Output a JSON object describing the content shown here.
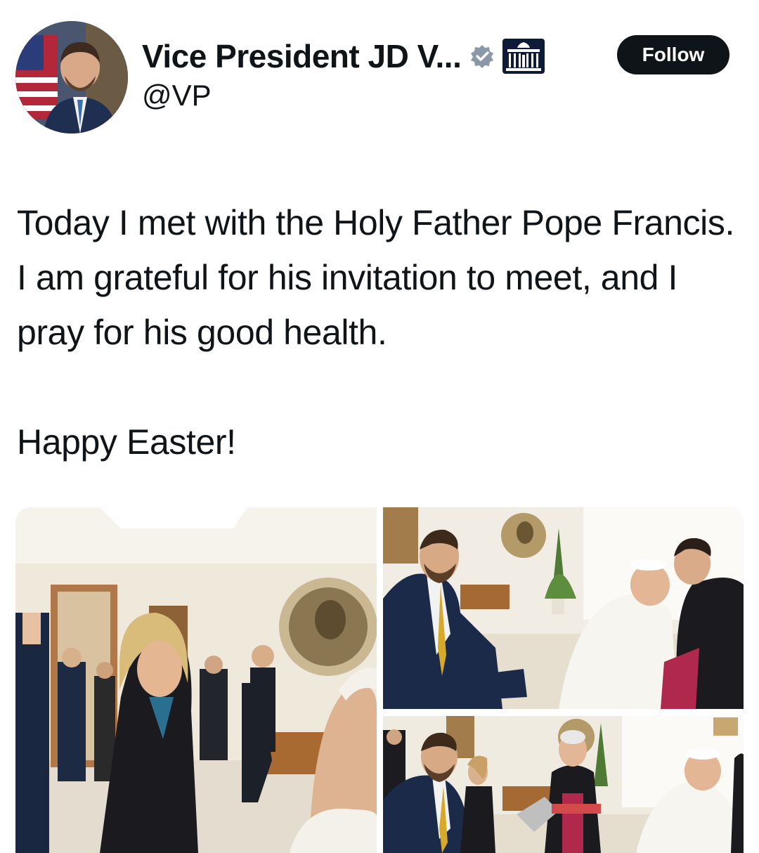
{
  "profile": {
    "display_name": "Vice President JD V...",
    "handle": "@VP",
    "avatar_alt": "avatar",
    "verified_icon": "verified-badge-icon",
    "affiliation_icon": "white-house-icon"
  },
  "actions": {
    "follow_label": "Follow"
  },
  "tweet": {
    "lines": [
      "Today I met with the Holy Father Pope Francis. I am grateful for his invitation to meet, and I pray for his good health.",
      "Happy Easter!"
    ]
  },
  "media": {
    "count": 3
  },
  "colors": {
    "text": "#0f1419",
    "follow_bg": "#0f1419",
    "follow_text": "#ffffff",
    "verified_badge": "#8a99a8",
    "background": "#ffffff"
  }
}
